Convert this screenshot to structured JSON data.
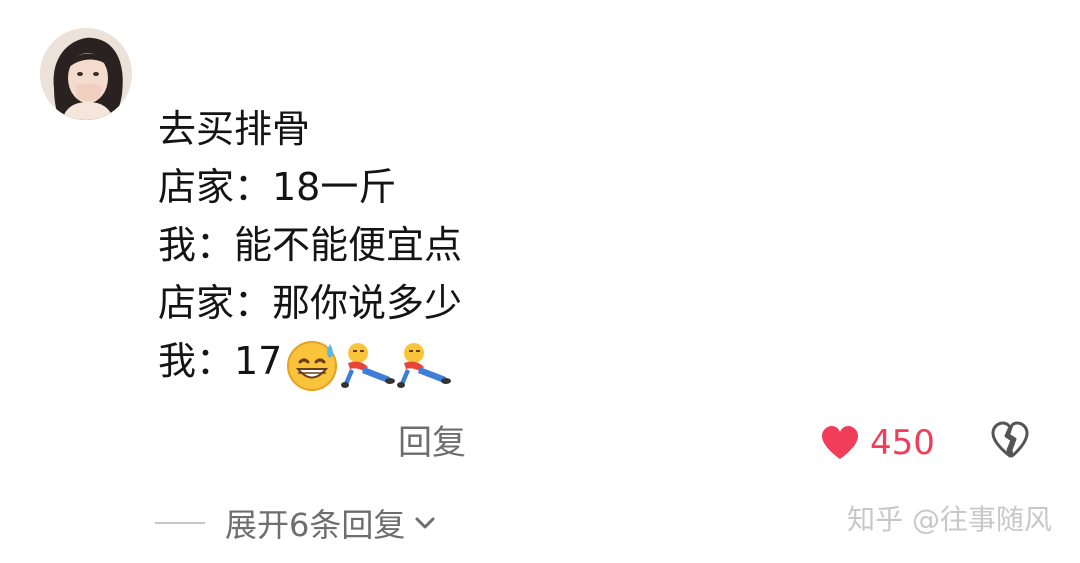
{
  "comment": {
    "avatar": "user-avatar-photo",
    "lines": [
      "去买排骨",
      "店家：18一斤",
      "我：能不能便宜点",
      "店家：那你说多少",
      "我：17"
    ],
    "emojis": [
      "grinning-sweat-emoji",
      "lying-down-emoji",
      "lying-down-emoji"
    ]
  },
  "actions": {
    "reply_label": "回复",
    "like_count": "450",
    "like_icon": "heart-icon",
    "dislike_icon": "broken-heart-icon",
    "like_color": "#ef3d5a"
  },
  "replies": {
    "expand_label": "展开6条回复",
    "expand_icon": "chevron-down-icon"
  },
  "watermark": "知乎 @往事随风"
}
